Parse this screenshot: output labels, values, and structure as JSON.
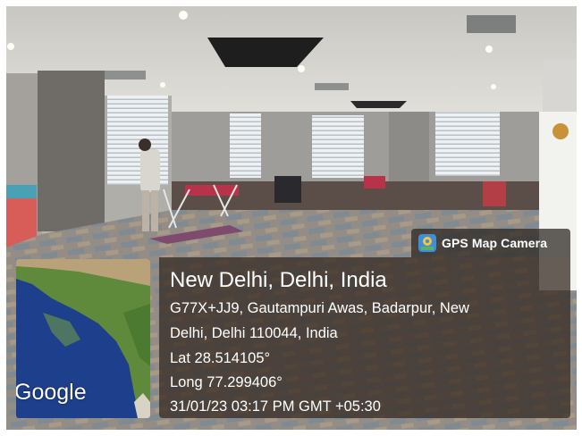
{
  "badge": {
    "icon": "gps-map-camera-icon",
    "label": "GPS Map Camera"
  },
  "location": {
    "title": "New Delhi, Delhi, India",
    "address_line1": "G77X+JJ9, Gautampuri Awas, Badarpur, New",
    "address_line2": "Delhi, Delhi 110044, India",
    "lat": "Lat 28.514105°",
    "long": "Long 77.299406°",
    "datetime": "31/01/23 03:17 PM GMT +05:30"
  },
  "map": {
    "logo": "Google"
  },
  "colors": {
    "overlay": "#342820",
    "text": "#ffffff",
    "water": "#1e3f8c",
    "land": "#5f8a3c"
  }
}
